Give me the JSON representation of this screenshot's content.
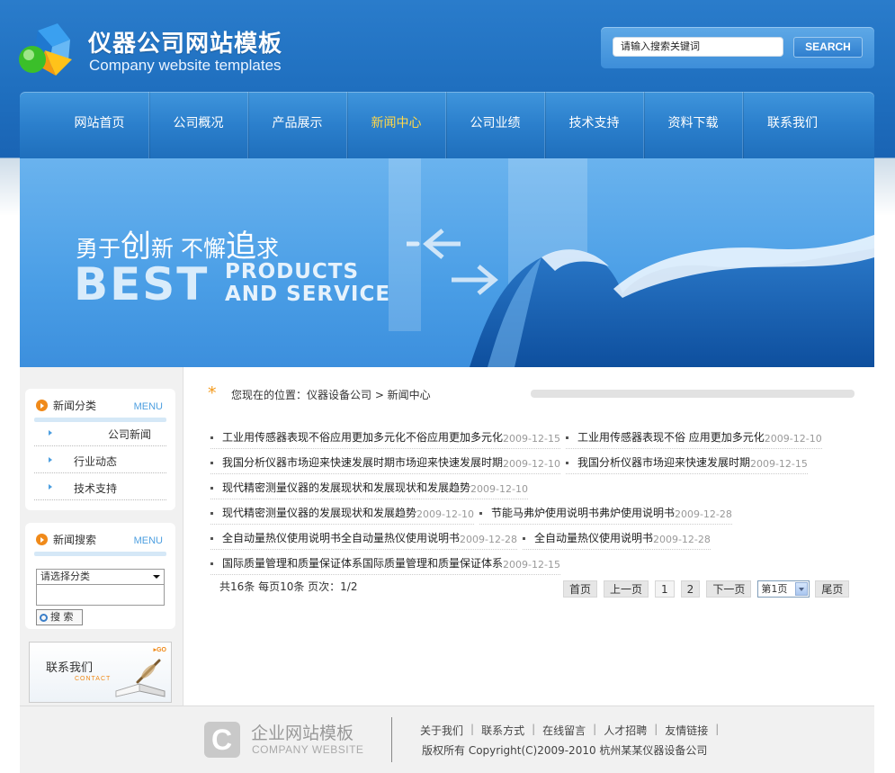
{
  "header": {
    "title": "仪器公司网站模板",
    "subtitle": "Company website templates",
    "search": {
      "value": "请输入搜索关键词",
      "button": "SEARCH"
    }
  },
  "nav": {
    "items": [
      "网站首页",
      "公司概况",
      "产品展示",
      "新闻中心",
      "公司业绩",
      "技术支持",
      "资料下载",
      "联系我们"
    ],
    "active_index": 3
  },
  "banner": {
    "slogan_a": "勇于",
    "slogan_b": "创",
    "slogan_c": "新 不懈",
    "slogan_d": "追",
    "slogan_e": "求",
    "best": "BEST",
    "products_line1": "PRODUCTS",
    "products_line2": "AND SERVICE"
  },
  "sidebar": {
    "news_category": {
      "title": "新闻分类",
      "menu": "MENU",
      "items": [
        "公司新闻",
        "行业动态",
        "技术支持"
      ]
    },
    "news_search": {
      "title": "新闻搜索",
      "menu": "MENU",
      "select_value": "请选择分类",
      "button": "搜 索"
    },
    "contact": {
      "title": "联系我们",
      "en": "CONTACT",
      "go": "GO"
    }
  },
  "main": {
    "breadcrumb": "您现在的位置：仪器设备公司 > 新闻中心",
    "news_rows": [
      [
        {
          "title": "工业用传感器表现不俗应用更加多元化不俗应用更加多元化",
          "date": "2009-12-15"
        },
        {
          "title": "工业用传感器表现不俗 应用更加多元化",
          "date": "2009-12-10"
        }
      ],
      [
        {
          "title": "我国分析仪器市场迎来快速发展时期市场迎来快速发展时期",
          "date": "2009-12-10"
        },
        {
          "title": "我国分析仪器市场迎来快速发展时期",
          "date": "2009-12-15"
        }
      ],
      [
        {
          "title": "现代精密测量仪器的发展现状和发展现状和发展趋势",
          "date": "2009-12-10"
        }
      ],
      [
        {
          "title": "现代精密测量仪器的发展现状和发展趋势",
          "date": "2009-12-10"
        },
        {
          "title": "节能马弗炉使用说明书弗炉使用说明书",
          "date": "2009-12-28"
        }
      ],
      [
        {
          "title": "全自动量热仪使用说明书全自动量热仪使用说明书",
          "date": "2009-12-28"
        },
        {
          "title": "全自动量热仪使用说明书",
          "date": "2009-12-28"
        }
      ],
      [
        {
          "title": "国际质量管理和质量保证体系国际质量管理和质量保证体系",
          "date": "2009-12-15"
        }
      ]
    ],
    "pager": {
      "info": "共16条 每页10条 页次：1/2",
      "first": "首页",
      "prev": "上一页",
      "pages": [
        "1",
        "2"
      ],
      "next": "下一页",
      "select": "第1页",
      "last": "尾页"
    }
  },
  "footer": {
    "logo_letter": "C",
    "brand_cn": "企业网站模板",
    "brand_en": "COMPANY WEBSITE",
    "links": [
      "关于我们",
      "联系方式",
      "在线留言",
      "人才招聘",
      "友情链接"
    ],
    "copyright": "版权所有 Copyright(C)2009-2010 杭州某某仪器设备公司"
  }
}
